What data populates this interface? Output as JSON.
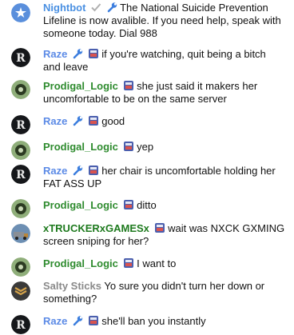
{
  "colors": {
    "nightbot": "#4a90e2",
    "raze": "#5b8ae6",
    "prodigal": "#2e8b2e",
    "trucker": "#1e7a1e",
    "salty": "#8a8a8a",
    "text": "#111111"
  },
  "messages": [
    {
      "user": "Nightbot",
      "text": "The National Suicide Prevention Lifeline is now avalible. If you need help, speak with someone today. Dial 988"
    },
    {
      "user": "Raze",
      "text": "if you're watching, quit being a bitch and leave"
    },
    {
      "user": "Prodigal_Logic",
      "text": "she just said it makers her uncomfortable to be on the same server"
    },
    {
      "user": "Raze",
      "text": "good"
    },
    {
      "user": "Prodigal_Logic",
      "text": "yep"
    },
    {
      "user": "Raze",
      "text": "her chair is uncomfortable holding her FAT ASS UP"
    },
    {
      "user": "Prodigal_Logic",
      "text": "ditto"
    },
    {
      "user": "xTRUCKERxGAMESx",
      "text": "wait was NXCK GXMING screen sniping for her?"
    },
    {
      "user": "Prodigal_Logic",
      "text": "I want to"
    },
    {
      "user": "Salty Sticks",
      "text": "Yo sure you didn't turn her down or something?"
    },
    {
      "user": "Raze",
      "text": "she'll ban you instantly"
    }
  ]
}
